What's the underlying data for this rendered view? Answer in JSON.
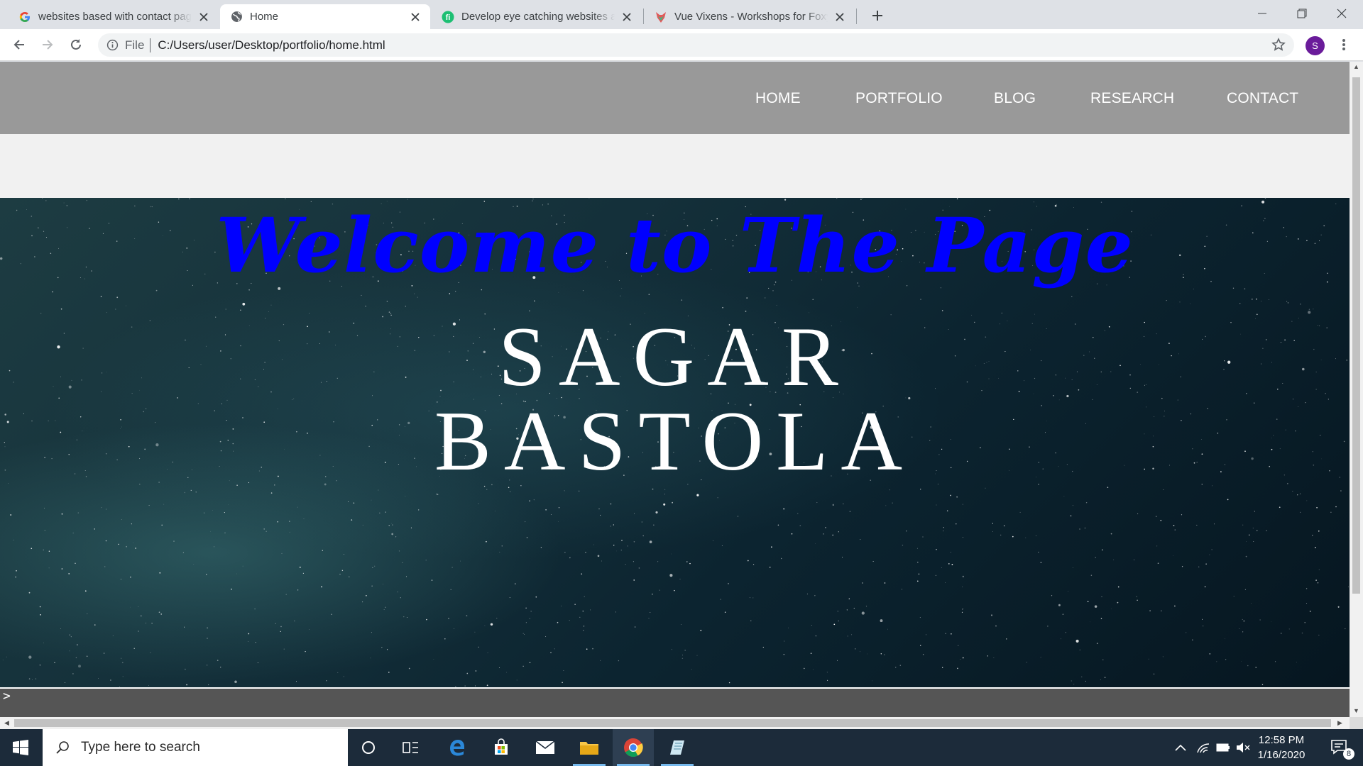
{
  "browser": {
    "tabs": [
      {
        "title": "websites based with contact page",
        "icon": "google-g-icon"
      },
      {
        "title": "Home",
        "icon": "globe-icon",
        "active": true
      },
      {
        "title": "Develop eye catching websites and",
        "icon": "fiverr-icon"
      },
      {
        "title": "Vue Vixens - Workshops for Foxy",
        "icon": "vue-vixens-fox-icon"
      }
    ],
    "address": {
      "scheme_label": "File",
      "url": "C:/Users/user/Desktop/portfolio/home.html"
    },
    "profile_initial": "S",
    "accent_color": "#6a1b9a"
  },
  "page": {
    "nav": [
      "HOME",
      "PORTFOLIO",
      "BLOG",
      "RESEARCH",
      "CONTACT"
    ],
    "welcome": "Welcome to The Page",
    "name_line1": "SAGAR",
    "name_line2": "BASTOLA",
    "terminal_prompt": ">",
    "colors": {
      "nav_bg": "#999999",
      "welcome_text": "#0000ff",
      "name_text": "#ffffff"
    }
  },
  "taskbar": {
    "search_placeholder": "Type here to search",
    "time": "12:58 PM",
    "date": "1/16/2020",
    "notification_count": "8"
  }
}
